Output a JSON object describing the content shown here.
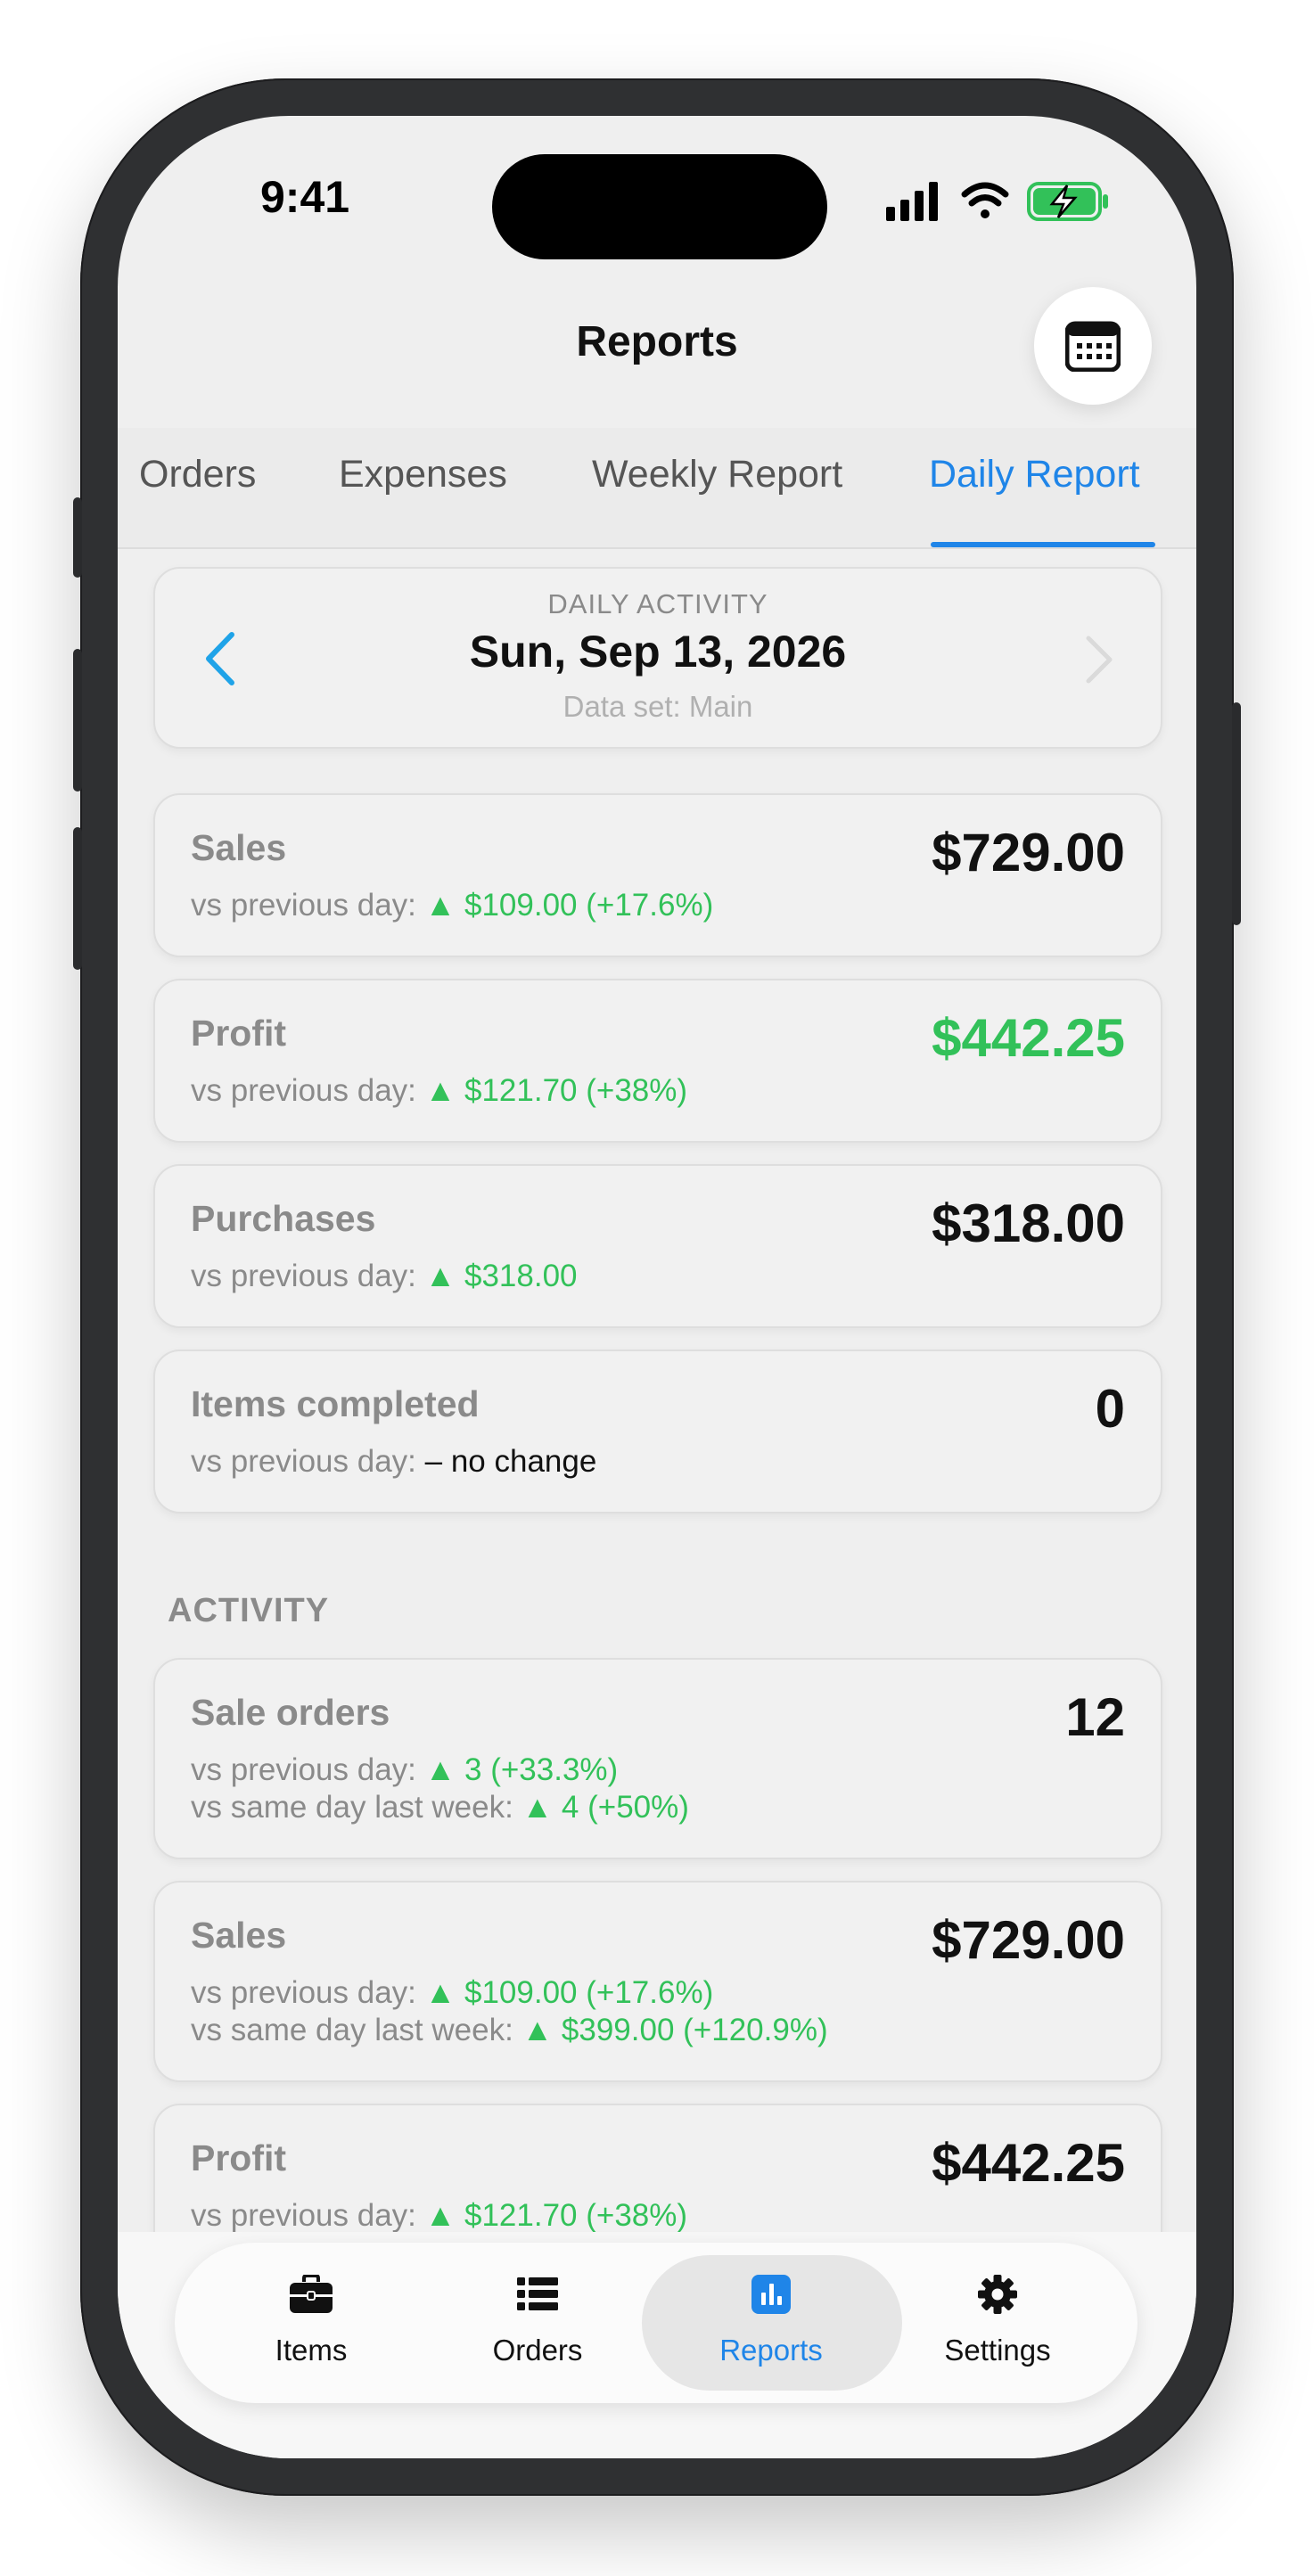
{
  "status": {
    "time": "9:41"
  },
  "header": {
    "title": "Reports",
    "calendar_icon": "calendar-icon"
  },
  "tabs": [
    {
      "label": "Orders",
      "active": false
    },
    {
      "label": "Expenses",
      "active": false
    },
    {
      "label": "Weekly Report",
      "active": false
    },
    {
      "label": "Daily Report",
      "active": true
    }
  ],
  "date_card": {
    "caption": "DAILY ACTIVITY",
    "date": "Sun, Sep 13, 2026",
    "dataset": "Data set: Main"
  },
  "summary": [
    {
      "label": "Sales",
      "value": "$729.00",
      "value_color": "default",
      "prefix": "vs previous day:",
      "change": "▲ $109.00 (+17.6%)"
    },
    {
      "label": "Profit",
      "value": "$442.25",
      "value_color": "green",
      "prefix": "vs previous day:",
      "change": "▲ $121.70 (+38%)"
    },
    {
      "label": "Purchases",
      "value": "$318.00",
      "value_color": "default",
      "prefix": "vs previous day:",
      "change": "▲ $318.00"
    },
    {
      "label": "Items completed",
      "value": "0",
      "value_color": "default",
      "prefix": "vs previous day:",
      "change": "– no change"
    }
  ],
  "activity": {
    "section_label": "ACTIVITY",
    "cards": [
      {
        "label": "Sale orders",
        "value": "12",
        "prev_prefix": "vs previous day:",
        "prev_change": "▲ 3 (+33.3%)",
        "week_prefix": "vs same day last week:",
        "week_change": "▲ 4 (+50%)"
      },
      {
        "label": "Sales",
        "value": "$729.00",
        "prev_prefix": "vs previous day:",
        "prev_change": "▲ $109.00 (+17.6%)",
        "week_prefix": "vs same day last week:",
        "week_change": "▲ $399.00 (+120.9%)"
      },
      {
        "label": "Profit",
        "value": "$442.25",
        "prev_prefix": "vs previous day:",
        "prev_change": "▲ $121.70 (+38%)"
      }
    ]
  },
  "tabbar": [
    {
      "label": "Items",
      "icon": "briefcase-icon",
      "active": false
    },
    {
      "label": "Orders",
      "icon": "list-icon",
      "active": false
    },
    {
      "label": "Reports",
      "icon": "chart-icon",
      "active": true
    },
    {
      "label": "Settings",
      "icon": "gear-icon",
      "active": false
    }
  ],
  "colors": {
    "accent": "#1f85e8",
    "positive": "#32c159",
    "muted": "#8a8a8a"
  }
}
